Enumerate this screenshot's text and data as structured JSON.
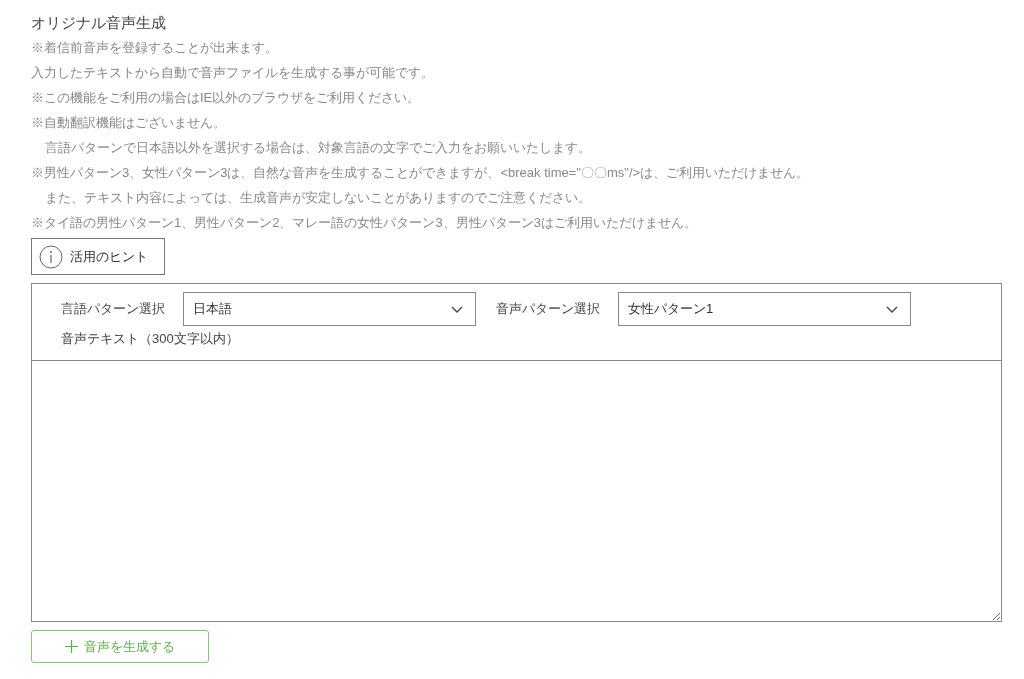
{
  "title": "オリジナル音声生成",
  "notes": [
    {
      "text": "※着信前音声を登録することが出来ます。",
      "indented": false
    },
    {
      "text": "入力したテキストから自動で音声ファイルを生成する事が可能です。",
      "indented": false
    },
    {
      "text": "※この機能をご利用の場合はIE以外のブラウザをご利用ください。",
      "indented": false
    },
    {
      "text": "※自動翻訳機能はございません。",
      "indented": false
    },
    {
      "text": "言語パターンで日本語以外を選択する場合は、対象言語の文字でご入力をお願いいたします。",
      "indented": true
    },
    {
      "text": "※男性パターン3、女性パターン3は、自然な音声を生成することができますが、<break time=\"〇〇ms\"/>は、ご利用いただけません。",
      "indented": false
    },
    {
      "text": "また、テキスト内容によっては、生成音声が安定しないことがありますのでご注意ください。",
      "indented": true
    },
    {
      "text": "※タイ語の男性パターン1、男性パターン2、マレー語の女性パターン3、男性パターン3はご利用いただけません。",
      "indented": false
    }
  ],
  "hint_button": {
    "label": "活用のヒント"
  },
  "form": {
    "selects": [
      {
        "label": "言語パターン選択",
        "value": "日本語"
      },
      {
        "label": "音声パターン選択",
        "value": "女性パターン1"
      }
    ],
    "text_label": "音声テキスト（300文字以内）"
  },
  "generate_button": {
    "label": "音声を生成する"
  }
}
